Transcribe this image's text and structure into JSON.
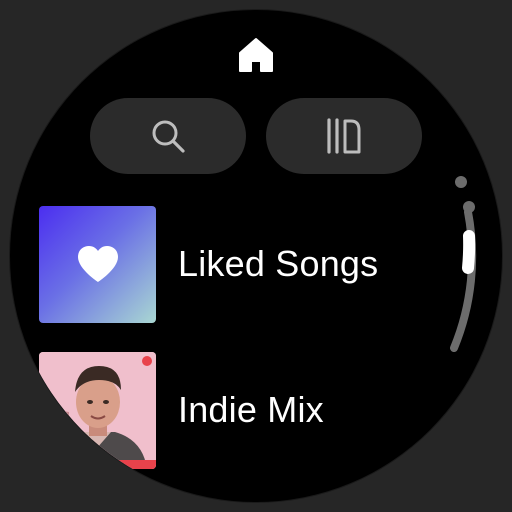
{
  "header": {
    "icon": "home-icon"
  },
  "actions": [
    {
      "name": "search",
      "icon": "search-icon"
    },
    {
      "name": "library",
      "icon": "library-icon"
    }
  ],
  "list": {
    "items": [
      {
        "title": "Liked Songs",
        "cover_icon": "heart-icon"
      },
      {
        "title": "Indie Mix",
        "cover_icon": "playlist-cover-image"
      }
    ]
  },
  "scroll": {
    "position_fraction": 0.1
  },
  "colors": {
    "background": "#000000",
    "pill": "#2b2b2b",
    "text": "#ffffff",
    "liked_gradient_start": "#4b2ef0",
    "liked_gradient_end": "#a9d7d2",
    "scroll_inactive": "#6c6c6c",
    "scroll_active": "#ffffff"
  }
}
